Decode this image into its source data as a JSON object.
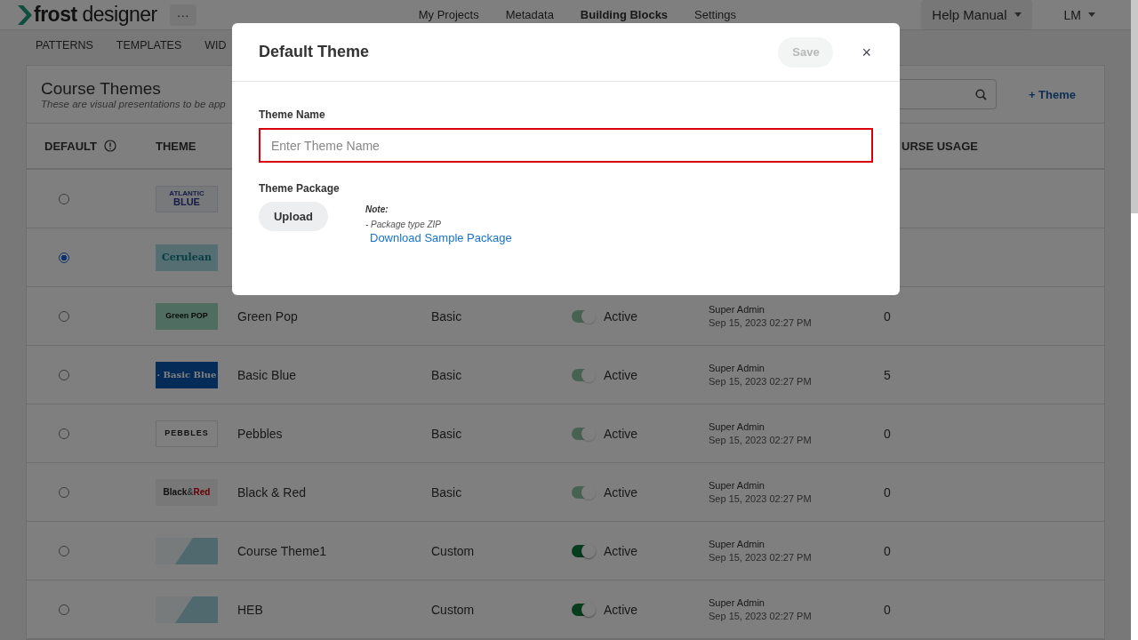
{
  "header": {
    "logo": "**frost** designer",
    "more": "···",
    "nav": [
      {
        "label": "My Projects",
        "selected": false
      },
      {
        "label": "Metadata",
        "selected": false
      },
      {
        "label": "Building Blocks",
        "selected": true
      },
      {
        "label": "Settings",
        "selected": false
      }
    ],
    "help": "Help Manual",
    "user": "LM"
  },
  "subnav": [
    {
      "label": "PATTERNS"
    },
    {
      "label": "TEMPLATES"
    },
    {
      "label": "WID"
    }
  ],
  "card": {
    "title": "Course Themes",
    "subtitle": "These are visual presentations to be app",
    "add": "+ Theme"
  },
  "table": {
    "columns": [
      {
        "label": "DEFAULT",
        "info": true
      },
      {
        "label": "THEME"
      },
      {
        "label": "URSE USAGE"
      }
    ],
    "rows": [
      {
        "selected": false,
        "thumbnail": {
          "kind": "atlantic",
          "text": [
            "ATLANTIC",
            "BLUE"
          ]
        }
      },
      {
        "selected": true,
        "thumbnail": {
          "kind": "cerulean",
          "text": [
            "Cerulean"
          ]
        }
      },
      {
        "selected": false,
        "thumbnail": {
          "kind": "green",
          "text": [
            "Green POP"
          ]
        },
        "name": "Green Pop",
        "type": "Basic",
        "on": true,
        "disabled": true,
        "status": "Active",
        "created_by": "Super Admin",
        "created_at": "Sep 15, 2023 02:27 PM",
        "usage": "0"
      },
      {
        "selected": false,
        "thumbnail": {
          "kind": "blue",
          "text": [
            "· Basic Blue"
          ]
        },
        "name": "Basic Blue",
        "type": "Basic",
        "on": true,
        "disabled": true,
        "status": "Active",
        "created_by": "Super Admin",
        "created_at": "Sep 15, 2023 02:27 PM",
        "usage": "5"
      },
      {
        "selected": false,
        "thumbnail": {
          "kind": "pebbles",
          "text": [
            "PEBBLES"
          ]
        },
        "name": "Pebbles",
        "type": "Basic",
        "on": true,
        "disabled": true,
        "status": "Active",
        "created_by": "Super Admin",
        "created_at": "Sep 15, 2023 02:27 PM",
        "usage": "0"
      },
      {
        "selected": false,
        "thumbnail": {
          "kind": "blackred",
          "text": [
            "Black",
            "&",
            "Red"
          ]
        },
        "name": "Black & Red",
        "type": "Basic",
        "on": true,
        "disabled": true,
        "status": "Active",
        "created_by": "Super Admin",
        "created_at": "Sep 15, 2023 02:27 PM",
        "usage": "0"
      },
      {
        "selected": false,
        "thumbnail": {
          "kind": "diagonal"
        },
        "name": "Course Theme1",
        "type": "Custom",
        "on": true,
        "disabled": false,
        "status": "Active",
        "created_by": "Super Admin",
        "created_at": "Sep 15, 2023 02:27 PM",
        "usage": "0"
      },
      {
        "selected": false,
        "thumbnail": {
          "kind": "diagonal"
        },
        "name": "HEB",
        "type": "Custom",
        "on": true,
        "disabled": false,
        "status": "Active",
        "created_by": "Super Admin",
        "created_at": "Sep 15, 2023 02:27 PM",
        "usage": "0"
      }
    ]
  },
  "modal": {
    "title": "Default Theme",
    "save": {
      "label": "Save",
      "disabled": true
    },
    "close": "×",
    "name_label": "Theme Name",
    "name_field": {
      "placeholder": "Enter Theme Name",
      "error": true
    },
    "package_label": "Theme Package",
    "upload": "Upload",
    "note_title": "Note:",
    "note": "- Package type ZIP",
    "download": "Download Sample Package"
  }
}
